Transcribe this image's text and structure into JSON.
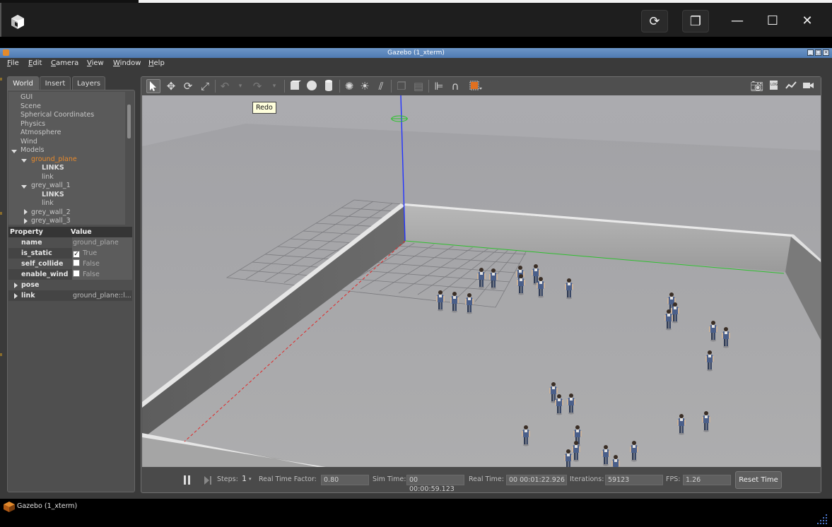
{
  "host": {
    "buttons": [
      "⟳",
      "❐",
      "—",
      "☐",
      "✕"
    ]
  },
  "window": {
    "title": "Gazebo (1_xterm)",
    "title_buttons": [
      "_",
      "□",
      "×"
    ]
  },
  "menubar": [
    {
      "label": "File",
      "accel": "F",
      "rest": "ile"
    },
    {
      "label": "Edit",
      "accel": "E",
      "rest": "dit"
    },
    {
      "label": "Camera",
      "accel": "C",
      "rest": "amera"
    },
    {
      "label": "View",
      "accel": "V",
      "rest": "iew"
    },
    {
      "label": "Window",
      "accel": "W",
      "rest": "indow"
    },
    {
      "label": "Help",
      "accel": "H",
      "rest": "elp"
    }
  ],
  "tabs": [
    "World",
    "Insert",
    "Layers"
  ],
  "tree": {
    "gui": "GUI",
    "scene": "Scene",
    "spherical": "Spherical Coordinates",
    "physics": "Physics",
    "atmosphere": "Atmosphere",
    "wind": "Wind",
    "models": "Models",
    "ground_plane": "ground_plane",
    "links_1": "LINKS",
    "link_1": "link",
    "grey_wall_1": "grey_wall_1",
    "links_2": "LINKS",
    "link_2": "link",
    "grey_wall_2": "grey_wall_2",
    "grey_wall_3": "grey_wall_3"
  },
  "properties": {
    "header_property": "Property",
    "header_value": "Value",
    "rows": [
      {
        "key": "name",
        "value": "ground_plane"
      },
      {
        "key": "is_static",
        "value": "True",
        "checked": true
      },
      {
        "key": "self_collide",
        "value": "False",
        "checked": false
      },
      {
        "key": "enable_wind",
        "value": "False",
        "checked": false
      },
      {
        "key": "pose",
        "value": ""
      },
      {
        "key": "link",
        "value": "ground_plane::l..."
      }
    ]
  },
  "tooltip": "Redo",
  "bottom": {
    "steps_label": "Steps:",
    "steps_value": "1",
    "rtf_label": "Real Time Factor:",
    "rtf_value": "0.80",
    "sim_label": "Sim Time:",
    "sim_value": "00 00:00:59.123",
    "real_label": "Real Time:",
    "real_value": "00 00:01:22.926",
    "iter_label": "Iterations:",
    "iter_value": "59123",
    "fps_label": "FPS:",
    "fps_value": "1.26",
    "reset_label": "Reset Time"
  },
  "taskbar": {
    "label": "Gazebo (1_xterm)"
  },
  "colors": {
    "selected_model": "#e88a2c",
    "x_axis": "#ff3333",
    "y_axis": "#33cc33",
    "z_axis": "#2233ff"
  }
}
